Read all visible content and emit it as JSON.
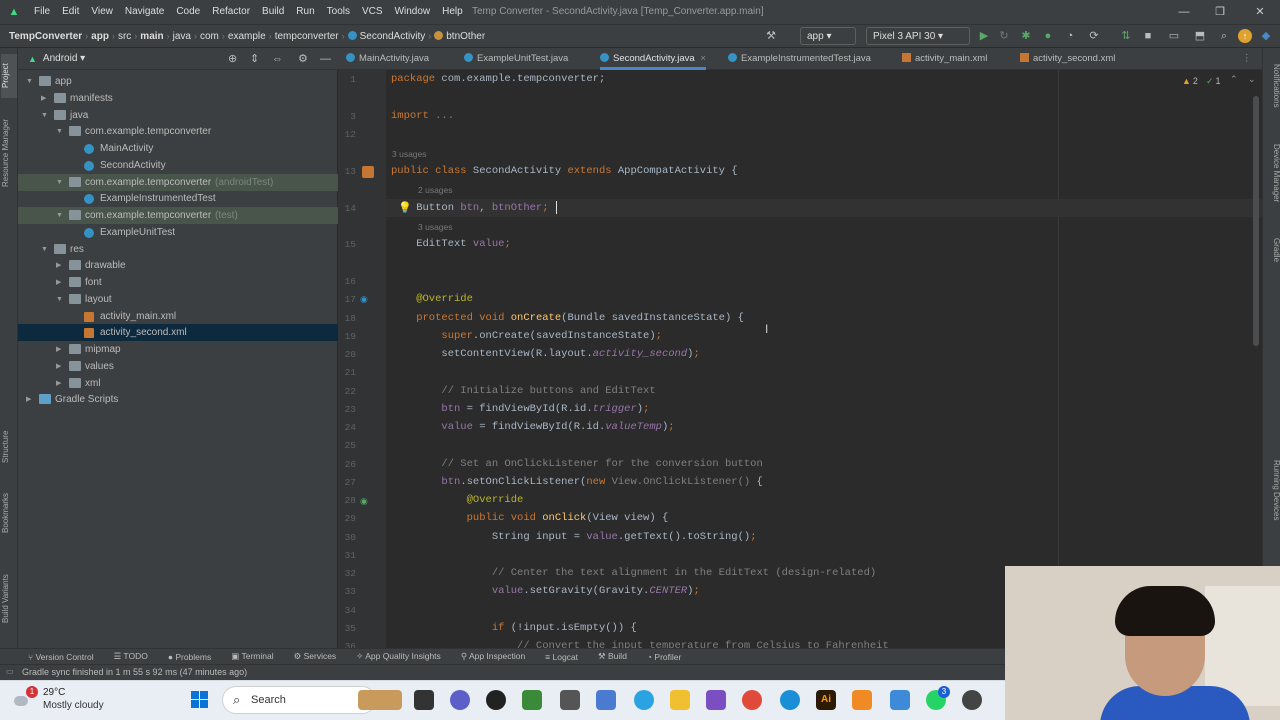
{
  "menu": {
    "items": [
      "File",
      "Edit",
      "View",
      "Navigate",
      "Code",
      "Refactor",
      "Build",
      "Run",
      "Tools",
      "VCS",
      "Window",
      "Help"
    ],
    "window_title": "Temp Converter - SecondActivity.java [Temp_Converter.app.main]"
  },
  "breadcrumb": [
    "TempConverter",
    "app",
    "src",
    "main",
    "java",
    "com",
    "example",
    "tempconverter",
    "SecondActivity",
    "btnOther"
  ],
  "toolbar": {
    "run_config": "app",
    "device": "Pixel 3 API 30"
  },
  "project": {
    "view_mode": "Android",
    "tree": [
      {
        "label": "app",
        "depth": 0,
        "icon": "folder",
        "open": true
      },
      {
        "label": "manifests",
        "depth": 1,
        "icon": "folder",
        "open": false
      },
      {
        "label": "java",
        "depth": 1,
        "icon": "folder",
        "open": true
      },
      {
        "label": "com.example.tempconverter",
        "depth": 2,
        "icon": "folder",
        "open": true
      },
      {
        "label": "MainActivity",
        "depth": 3,
        "icon": "class"
      },
      {
        "label": "SecondActivity",
        "depth": 3,
        "icon": "class"
      },
      {
        "label": "com.example.tempconverter",
        "suffix": "(androidTest)",
        "depth": 2,
        "icon": "folder",
        "open": true,
        "test": true
      },
      {
        "label": "ExampleInstrumentedTest",
        "depth": 3,
        "icon": "class"
      },
      {
        "label": "com.example.tempconverter",
        "suffix": "(test)",
        "depth": 2,
        "icon": "folder",
        "open": true,
        "test": true
      },
      {
        "label": "ExampleUnitTest",
        "depth": 3,
        "icon": "class"
      },
      {
        "label": "res",
        "depth": 1,
        "icon": "folder",
        "open": true
      },
      {
        "label": "drawable",
        "depth": 2,
        "icon": "folder",
        "open": false
      },
      {
        "label": "font",
        "depth": 2,
        "icon": "folder",
        "open": false
      },
      {
        "label": "layout",
        "depth": 2,
        "icon": "folder",
        "open": true
      },
      {
        "label": "activity_main.xml",
        "depth": 3,
        "icon": "xml"
      },
      {
        "label": "activity_second.xml",
        "depth": 3,
        "icon": "xml",
        "selected": true
      },
      {
        "label": "mipmap",
        "depth": 2,
        "icon": "folder",
        "open": false
      },
      {
        "label": "values",
        "depth": 2,
        "icon": "folder",
        "open": false
      },
      {
        "label": "xml",
        "depth": 2,
        "icon": "folder",
        "open": false
      },
      {
        "label": "Gradle Scripts",
        "depth": 0,
        "icon": "gradle",
        "open": false
      }
    ]
  },
  "tabs": [
    {
      "label": "MainActivity.java",
      "kind": "class"
    },
    {
      "label": "ExampleUnitTest.java",
      "kind": "class"
    },
    {
      "label": "SecondActivity.java",
      "kind": "class",
      "active": true
    },
    {
      "label": "ExampleInstrumentedTest.java",
      "kind": "class"
    },
    {
      "label": "activity_main.xml",
      "kind": "xml"
    },
    {
      "label": "activity_second.xml",
      "kind": "xml"
    }
  ],
  "inspection": {
    "warnings": "2",
    "ok": "1"
  },
  "code": {
    "hints": {
      "h13": "3 usages",
      "h14": "2 usages",
      "h15": "3 usages"
    },
    "lines": [
      {
        "n": "1",
        "segs": [
          [
            "kw",
            "package "
          ],
          [
            "",
            "com.example.tempconverter;"
          ]
        ]
      },
      {
        "n": "3",
        "segs": [
          [
            "kw",
            "import "
          ],
          [
            "cm",
            "..."
          ]
        ]
      },
      {
        "n": "12",
        "segs": []
      },
      {
        "n": "13",
        "segs": [
          [
            "kw",
            "public class "
          ],
          [
            "",
            "SecondActivity "
          ],
          [
            "kw",
            "extends "
          ],
          [
            "",
            "AppCompatActivity {"
          ]
        ]
      },
      {
        "n": "14",
        "segs": [
          [
            "",
            "    Button "
          ],
          [
            "fld",
            "btn"
          ],
          [
            "",
            ", "
          ],
          [
            "fld",
            "btnOther"
          ],
          [
            "kw",
            ";"
          ]
        ]
      },
      {
        "n": "15",
        "segs": [
          [
            "",
            "    EditText "
          ],
          [
            "fld",
            "value"
          ],
          [
            "kw",
            ";"
          ]
        ]
      },
      {
        "n": "16",
        "segs": []
      },
      {
        "n": "17",
        "segs": [
          [
            "ann",
            "    @Override"
          ]
        ]
      },
      {
        "n": "18",
        "segs": [
          [
            "kw",
            "    protected void "
          ],
          [
            "fn",
            "onCreate"
          ],
          [
            "",
            "(Bundle savedInstanceState) {"
          ]
        ]
      },
      {
        "n": "19",
        "segs": [
          [
            "kw",
            "        super"
          ],
          [
            "",
            ".onCreate(savedInstanceState)"
          ],
          [
            "kw",
            ";"
          ]
        ]
      },
      {
        "n": "20",
        "segs": [
          [
            "",
            "        setContentView(R.layout."
          ],
          [
            "it",
            "activity_second"
          ],
          [
            "",
            ")"
          ],
          [
            "kw",
            ";"
          ]
        ]
      },
      {
        "n": "21",
        "segs": []
      },
      {
        "n": "22",
        "segs": [
          [
            "cm",
            "        // Initialize buttons and EditText"
          ]
        ]
      },
      {
        "n": "23",
        "segs": [
          [
            "fld",
            "        btn "
          ],
          [
            "",
            "= findViewById(R.id."
          ],
          [
            "it",
            "trigger"
          ],
          [
            "",
            ")"
          ],
          [
            "kw",
            ";"
          ]
        ]
      },
      {
        "n": "24",
        "segs": [
          [
            "fld",
            "        value "
          ],
          [
            "",
            "= findViewById(R.id."
          ],
          [
            "it",
            "valueTemp"
          ],
          [
            "",
            ")"
          ],
          [
            "kw",
            ";"
          ]
        ]
      },
      {
        "n": "25",
        "segs": []
      },
      {
        "n": "26",
        "segs": [
          [
            "cm",
            "        // Set an OnClickListener for the conversion button"
          ]
        ]
      },
      {
        "n": "27",
        "segs": [
          [
            "fld",
            "        btn"
          ],
          [
            "",
            ".setOnClickListener("
          ],
          [
            "kw",
            "new "
          ],
          [
            "cm",
            "View.OnClickListener() "
          ],
          [
            "",
            "{"
          ]
        ]
      },
      {
        "n": "28",
        "segs": [
          [
            "ann",
            "            @Override"
          ]
        ]
      },
      {
        "n": "29",
        "segs": [
          [
            "kw",
            "            public void "
          ],
          [
            "fn",
            "onClick"
          ],
          [
            "",
            "(View view) {"
          ]
        ]
      },
      {
        "n": "30",
        "segs": [
          [
            "",
            "                String input = "
          ],
          [
            "fld",
            "value"
          ],
          [
            "",
            ".getText().toString()"
          ],
          [
            "kw",
            ";"
          ]
        ]
      },
      {
        "n": "31",
        "segs": []
      },
      {
        "n": "32",
        "segs": [
          [
            "cm",
            "                // Center the text alignment in the EditText (design-related)"
          ]
        ]
      },
      {
        "n": "33",
        "segs": [
          [
            "fld",
            "                value"
          ],
          [
            "",
            ".setGravity(Gravity."
          ],
          [
            "it",
            "CENTER"
          ],
          [
            "",
            ")"
          ],
          [
            "kw",
            ";"
          ]
        ]
      },
      {
        "n": "34",
        "segs": []
      },
      {
        "n": "35",
        "segs": [
          [
            "kw",
            "                if "
          ],
          [
            "",
            "(!input.isEmpty()) {"
          ]
        ]
      },
      {
        "n": "36",
        "segs": [
          [
            "cm",
            "                    // Convert the input temperature from Celsius to Fahrenheit"
          ]
        ]
      }
    ]
  },
  "left_strip": [
    "Project",
    "Resource Manager",
    "Structure",
    "Bookmarks",
    "Build Variants"
  ],
  "right_strip": [
    "Notifications",
    "Device Manager",
    "Gradle",
    "Running Devices"
  ],
  "bottom_tools": [
    "Version Control",
    "TODO",
    "Problems",
    "Terminal",
    "Services",
    "App Quality Insights",
    "App Inspection",
    "Logcat",
    "Build",
    "Profiler"
  ],
  "status": {
    "message": "Gradle sync finished in 1 m 55 s 92 ms (47 minutes ago)"
  },
  "taskbar": {
    "temp": "29°C",
    "weather": "Mostly cloudy",
    "notif_badge": "1",
    "search": "Search",
    "badge_app": "3"
  }
}
